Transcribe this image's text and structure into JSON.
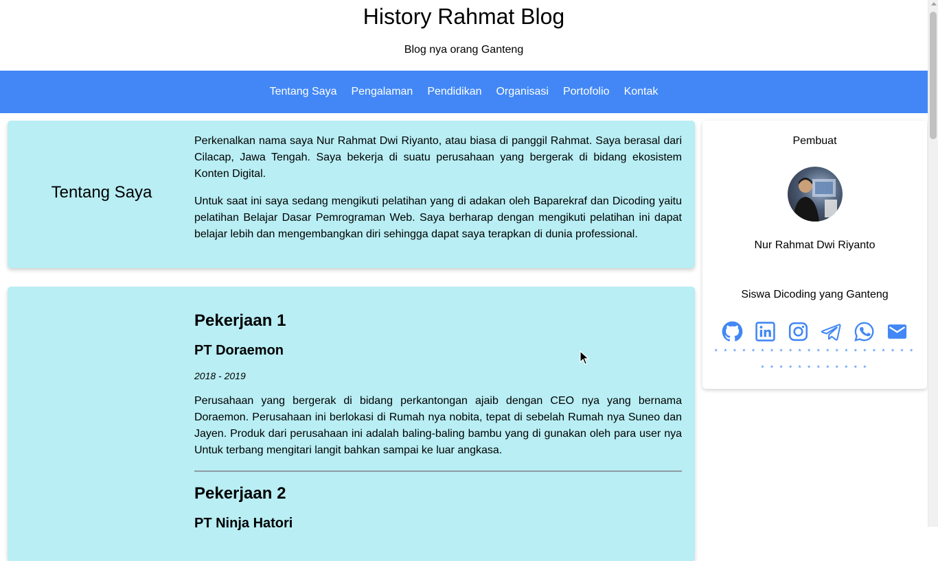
{
  "site": {
    "title": "History Rahmat Blog",
    "subtitle": "Blog nya orang Ganteng"
  },
  "nav": {
    "items": [
      {
        "label": "Tentang Saya"
      },
      {
        "label": "Pengalaman"
      },
      {
        "label": "Pendidikan"
      },
      {
        "label": "Organisasi"
      },
      {
        "label": "Portofolio"
      },
      {
        "label": "Kontak"
      }
    ]
  },
  "about": {
    "title": "Tentang Saya",
    "paragraphs": [
      "Perkenalkan nama saya Nur Rahmat Dwi Riyanto, atau biasa di panggil Rahmat. Saya berasal dari Cilacap, Jawa Tengah. Saya bekerja di suatu perusahaan yang bergerak di bidang ekosistem Konten Digital.",
      "Untuk saat ini saya sedang mengikuti pelatihan yang di adakan oleh Baparekraf dan Dicoding yaitu pelatihan Belajar Dasar Pemrograman Web. Saya berharap dengan mengikuti pelatihan ini dapat belajar lebih dan mengembangkan diri sehingga dapat saya terapkan di dunia professional."
    ]
  },
  "experience": {
    "jobs": [
      {
        "heading": "Pekerjaan 1",
        "company": "PT Doraemon",
        "period": "2018 - 2019",
        "description": "Perusahaan yang bergerak di bidang perkantongan ajaib dengan CEO nya yang bernama Doraemon. Perusahaan ini berlokasi di Rumah nya nobita, tepat di sebelah Rumah nya Suneo dan Jayen. Produk dari perusahaan ini adalah baling-baling bambu yang di gunakan oleh para user nya Untuk terbang mengitari langit bahkan sampai ke luar angkasa."
      },
      {
        "heading": "Pekerjaan 2",
        "company": "PT Ninja Hatori"
      }
    ]
  },
  "profile": {
    "heading": "Pembuat",
    "name": "Nur Rahmat Dwi Riyanto",
    "tagline": "Siswa Dicoding yang Ganteng",
    "socials": [
      "github-icon",
      "linkedin-icon",
      "instagram-icon",
      "telegram-icon",
      "whatsapp-icon",
      "email-icon"
    ],
    "decoration": "* * * * * * * * * * * * * * * * * * * * * * * * * * * * * * * * * *"
  },
  "colors": {
    "nav_bg": "#4287f5",
    "card_bg": "#b8eef4",
    "icon": "#4287f5"
  }
}
